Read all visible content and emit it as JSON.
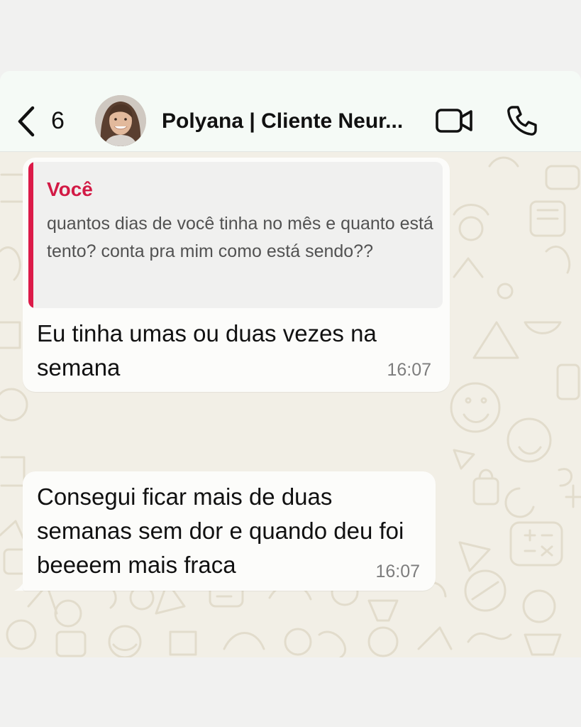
{
  "header": {
    "back_count": "6",
    "contact_name": "Polyana | Cliente Neur..."
  },
  "icons": {
    "back": "chevron-left-icon",
    "video": "video-camera-icon",
    "call": "phone-icon",
    "avatar": "contact-avatar"
  },
  "messages": [
    {
      "quote": {
        "author": "Você",
        "text": "quantos dias de você tinha no mês e quanto está tento? conta pra mim como está sendo??"
      },
      "text": "Eu tinha umas ou duas vezes na semana",
      "time": "16:07"
    },
    {
      "text": "Consegui ficar mais de duas semanas sem dor e quando deu foi beeeem mais fraca",
      "time": "16:07"
    }
  ],
  "colors": {
    "quote_accent": "#dc1a48",
    "header_bg": "#f5faf6",
    "chat_bg": "#f2efe6",
    "bubble_bg": "#fcfcfa"
  }
}
